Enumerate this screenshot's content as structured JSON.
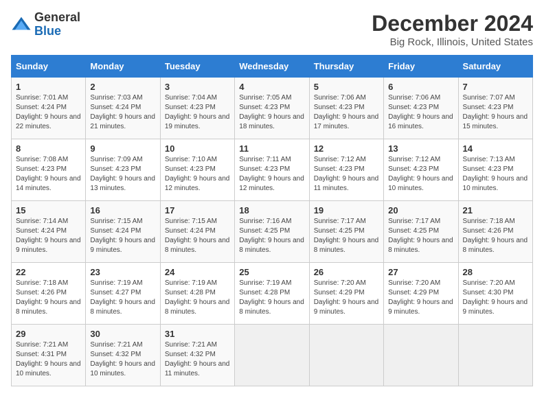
{
  "header": {
    "logo_general": "General",
    "logo_blue": "Blue",
    "title": "December 2024",
    "subtitle": "Big Rock, Illinois, United States"
  },
  "days_of_week": [
    "Sunday",
    "Monday",
    "Tuesday",
    "Wednesday",
    "Thursday",
    "Friday",
    "Saturday"
  ],
  "weeks": [
    [
      {
        "day": "1",
        "sunrise": "Sunrise: 7:01 AM",
        "sunset": "Sunset: 4:24 PM",
        "daylight": "Daylight: 9 hours and 22 minutes."
      },
      {
        "day": "2",
        "sunrise": "Sunrise: 7:03 AM",
        "sunset": "Sunset: 4:24 PM",
        "daylight": "Daylight: 9 hours and 21 minutes."
      },
      {
        "day": "3",
        "sunrise": "Sunrise: 7:04 AM",
        "sunset": "Sunset: 4:23 PM",
        "daylight": "Daylight: 9 hours and 19 minutes."
      },
      {
        "day": "4",
        "sunrise": "Sunrise: 7:05 AM",
        "sunset": "Sunset: 4:23 PM",
        "daylight": "Daylight: 9 hours and 18 minutes."
      },
      {
        "day": "5",
        "sunrise": "Sunrise: 7:06 AM",
        "sunset": "Sunset: 4:23 PM",
        "daylight": "Daylight: 9 hours and 17 minutes."
      },
      {
        "day": "6",
        "sunrise": "Sunrise: 7:06 AM",
        "sunset": "Sunset: 4:23 PM",
        "daylight": "Daylight: 9 hours and 16 minutes."
      },
      {
        "day": "7",
        "sunrise": "Sunrise: 7:07 AM",
        "sunset": "Sunset: 4:23 PM",
        "daylight": "Daylight: 9 hours and 15 minutes."
      }
    ],
    [
      {
        "day": "8",
        "sunrise": "Sunrise: 7:08 AM",
        "sunset": "Sunset: 4:23 PM",
        "daylight": "Daylight: 9 hours and 14 minutes."
      },
      {
        "day": "9",
        "sunrise": "Sunrise: 7:09 AM",
        "sunset": "Sunset: 4:23 PM",
        "daylight": "Daylight: 9 hours and 13 minutes."
      },
      {
        "day": "10",
        "sunrise": "Sunrise: 7:10 AM",
        "sunset": "Sunset: 4:23 PM",
        "daylight": "Daylight: 9 hours and 12 minutes."
      },
      {
        "day": "11",
        "sunrise": "Sunrise: 7:11 AM",
        "sunset": "Sunset: 4:23 PM",
        "daylight": "Daylight: 9 hours and 12 minutes."
      },
      {
        "day": "12",
        "sunrise": "Sunrise: 7:12 AM",
        "sunset": "Sunset: 4:23 PM",
        "daylight": "Daylight: 9 hours and 11 minutes."
      },
      {
        "day": "13",
        "sunrise": "Sunrise: 7:12 AM",
        "sunset": "Sunset: 4:23 PM",
        "daylight": "Daylight: 9 hours and 10 minutes."
      },
      {
        "day": "14",
        "sunrise": "Sunrise: 7:13 AM",
        "sunset": "Sunset: 4:23 PM",
        "daylight": "Daylight: 9 hours and 10 minutes."
      }
    ],
    [
      {
        "day": "15",
        "sunrise": "Sunrise: 7:14 AM",
        "sunset": "Sunset: 4:24 PM",
        "daylight": "Daylight: 9 hours and 9 minutes."
      },
      {
        "day": "16",
        "sunrise": "Sunrise: 7:15 AM",
        "sunset": "Sunset: 4:24 PM",
        "daylight": "Daylight: 9 hours and 9 minutes."
      },
      {
        "day": "17",
        "sunrise": "Sunrise: 7:15 AM",
        "sunset": "Sunset: 4:24 PM",
        "daylight": "Daylight: 9 hours and 8 minutes."
      },
      {
        "day": "18",
        "sunrise": "Sunrise: 7:16 AM",
        "sunset": "Sunset: 4:25 PM",
        "daylight": "Daylight: 9 hours and 8 minutes."
      },
      {
        "day": "19",
        "sunrise": "Sunrise: 7:17 AM",
        "sunset": "Sunset: 4:25 PM",
        "daylight": "Daylight: 9 hours and 8 minutes."
      },
      {
        "day": "20",
        "sunrise": "Sunrise: 7:17 AM",
        "sunset": "Sunset: 4:25 PM",
        "daylight": "Daylight: 9 hours and 8 minutes."
      },
      {
        "day": "21",
        "sunrise": "Sunrise: 7:18 AM",
        "sunset": "Sunset: 4:26 PM",
        "daylight": "Daylight: 9 hours and 8 minutes."
      }
    ],
    [
      {
        "day": "22",
        "sunrise": "Sunrise: 7:18 AM",
        "sunset": "Sunset: 4:26 PM",
        "daylight": "Daylight: 9 hours and 8 minutes."
      },
      {
        "day": "23",
        "sunrise": "Sunrise: 7:19 AM",
        "sunset": "Sunset: 4:27 PM",
        "daylight": "Daylight: 9 hours and 8 minutes."
      },
      {
        "day": "24",
        "sunrise": "Sunrise: 7:19 AM",
        "sunset": "Sunset: 4:28 PM",
        "daylight": "Daylight: 9 hours and 8 minutes."
      },
      {
        "day": "25",
        "sunrise": "Sunrise: 7:19 AM",
        "sunset": "Sunset: 4:28 PM",
        "daylight": "Daylight: 9 hours and 8 minutes."
      },
      {
        "day": "26",
        "sunrise": "Sunrise: 7:20 AM",
        "sunset": "Sunset: 4:29 PM",
        "daylight": "Daylight: 9 hours and 9 minutes."
      },
      {
        "day": "27",
        "sunrise": "Sunrise: 7:20 AM",
        "sunset": "Sunset: 4:29 PM",
        "daylight": "Daylight: 9 hours and 9 minutes."
      },
      {
        "day": "28",
        "sunrise": "Sunrise: 7:20 AM",
        "sunset": "Sunset: 4:30 PM",
        "daylight": "Daylight: 9 hours and 9 minutes."
      }
    ],
    [
      {
        "day": "29",
        "sunrise": "Sunrise: 7:21 AM",
        "sunset": "Sunset: 4:31 PM",
        "daylight": "Daylight: 9 hours and 10 minutes."
      },
      {
        "day": "30",
        "sunrise": "Sunrise: 7:21 AM",
        "sunset": "Sunset: 4:32 PM",
        "daylight": "Daylight: 9 hours and 10 minutes."
      },
      {
        "day": "31",
        "sunrise": "Sunrise: 7:21 AM",
        "sunset": "Sunset: 4:32 PM",
        "daylight": "Daylight: 9 hours and 11 minutes."
      },
      null,
      null,
      null,
      null
    ]
  ]
}
